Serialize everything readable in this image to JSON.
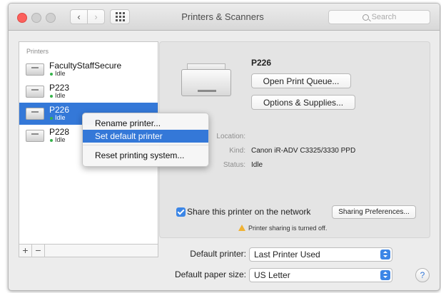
{
  "window": {
    "title": "Printers & Scanners"
  },
  "toolbar": {
    "search_placeholder": "Search"
  },
  "printers": {
    "header": "Printers",
    "items": [
      {
        "name": "FacultyStaffSecure",
        "status": "Idle"
      },
      {
        "name": "P223",
        "status": "Idle"
      },
      {
        "name": "P226",
        "status": "Idle",
        "selected": true
      },
      {
        "name": "P228",
        "status": "Idle"
      }
    ],
    "add_label": "+",
    "remove_label": "−"
  },
  "context_menu": {
    "items": [
      "Rename printer...",
      "Set default printer",
      "Reset printing system..."
    ],
    "highlighted": "Set default printer"
  },
  "detail": {
    "printer_name": "P226",
    "open_queue_label": "Open Print Queue...",
    "options_label": "Options & Supplies...",
    "location_label": "Location:",
    "location_value": "",
    "kind_label": "Kind:",
    "kind_value": "Canon iR-ADV C3325/3330 PPD",
    "status_label": "Status:",
    "status_value": "Idle",
    "share_label": "Share this printer on the network",
    "share_checked": true,
    "sharing_prefs_label": "Sharing Preferences...",
    "sharing_warning": "Printer sharing is turned off."
  },
  "defaults": {
    "printer_label": "Default printer:",
    "printer_value": "Last Printer Used",
    "paper_label": "Default paper size:",
    "paper_value": "US Letter"
  },
  "help_label": "?",
  "colors": {
    "accent": "#3478d8",
    "checkbox": "#3c86e6",
    "status_dot": "#36b34b",
    "warning": "#f0b234"
  }
}
